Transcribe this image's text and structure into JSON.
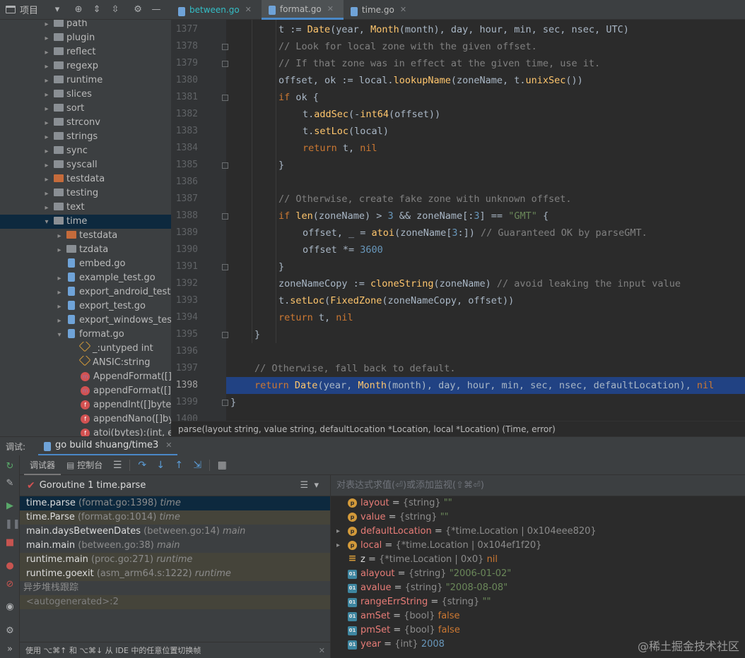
{
  "project_toolbar": {
    "title": "项目"
  },
  "tree": [
    {
      "label": "path",
      "kind": "folder",
      "depth": 0,
      "expanded": false
    },
    {
      "label": "plugin",
      "kind": "folder",
      "depth": 0,
      "expanded": false
    },
    {
      "label": "reflect",
      "kind": "folder",
      "depth": 0,
      "expanded": false
    },
    {
      "label": "regexp",
      "kind": "folder",
      "depth": 0,
      "expanded": false
    },
    {
      "label": "runtime",
      "kind": "folder",
      "depth": 0,
      "expanded": false
    },
    {
      "label": "slices",
      "kind": "folder",
      "depth": 0,
      "expanded": false
    },
    {
      "label": "sort",
      "kind": "folder",
      "depth": 0,
      "expanded": false
    },
    {
      "label": "strconv",
      "kind": "folder",
      "depth": 0,
      "expanded": false
    },
    {
      "label": "strings",
      "kind": "folder",
      "depth": 0,
      "expanded": false
    },
    {
      "label": "sync",
      "kind": "folder",
      "depth": 0,
      "expanded": false
    },
    {
      "label": "syscall",
      "kind": "folder",
      "depth": 0,
      "expanded": false
    },
    {
      "label": "testdata",
      "kind": "folder-orange",
      "depth": 0,
      "expanded": false
    },
    {
      "label": "testing",
      "kind": "folder",
      "depth": 0,
      "expanded": false
    },
    {
      "label": "text",
      "kind": "folder",
      "depth": 0,
      "expanded": false
    },
    {
      "label": "time",
      "kind": "folder",
      "depth": 0,
      "expanded": true,
      "selected": true
    },
    {
      "label": "testdata",
      "kind": "folder-orange",
      "depth": 1,
      "expanded": false
    },
    {
      "label": "tzdata",
      "kind": "folder",
      "depth": 1,
      "expanded": false
    },
    {
      "label": "embed.go",
      "kind": "gofile",
      "depth": 1,
      "leaf": true
    },
    {
      "label": "example_test.go",
      "kind": "gofile",
      "depth": 1,
      "expanded": false
    },
    {
      "label": "export_android_test",
      "kind": "gofile",
      "depth": 1,
      "expanded": false
    },
    {
      "label": "export_test.go",
      "kind": "gofile",
      "depth": 1,
      "expanded": false
    },
    {
      "label": "export_windows_tes",
      "kind": "gofile",
      "depth": 1,
      "expanded": false
    },
    {
      "label": "format.go",
      "kind": "gofile",
      "depth": 1,
      "expanded": true
    },
    {
      "label": "_:untyped int",
      "kind": "const",
      "depth": 2,
      "leaf": true
    },
    {
      "label": "ANSIC:string",
      "kind": "const",
      "depth": 2,
      "leaf": true
    },
    {
      "label": "AppendFormat([]b",
      "kind": "method",
      "depth": 2,
      "leaf": true
    },
    {
      "label": "appendFormat([]b",
      "kind": "method",
      "depth": 2,
      "leaf": true
    },
    {
      "label": "appendInt([]byte,",
      "kind": "func",
      "depth": 2,
      "leaf": true
    },
    {
      "label": "appendNano([]by",
      "kind": "func",
      "depth": 2,
      "leaf": true
    },
    {
      "label": "atoi(bytes):(int, e",
      "kind": "func",
      "depth": 2,
      "leaf": true
    }
  ],
  "tabs": [
    {
      "label": "between.go",
      "active": false,
      "style": "cyan"
    },
    {
      "label": "format.go",
      "active": true,
      "style": "normal"
    },
    {
      "label": "time.go",
      "active": false,
      "style": "normal"
    }
  ],
  "editor": {
    "current_line": "1398",
    "lines": [
      {
        "num": "1377",
        "indent": 2,
        "tokens": [
          [
            "t",
            "t :="
          ],
          [
            "t",
            " "
          ],
          [
            "fn",
            "Date"
          ],
          [
            "t",
            "(year, "
          ],
          [
            "fn",
            "Month"
          ],
          [
            "t",
            "(month), day, hour, min, sec, nsec, UTC)"
          ]
        ]
      },
      {
        "num": "1378",
        "indent": 2,
        "tokens": [
          [
            "c",
            "// Look for local zone with the given offset."
          ]
        ]
      },
      {
        "num": "1379",
        "indent": 2,
        "tokens": [
          [
            "c",
            "// If that zone was in effect at the given time, use it."
          ]
        ]
      },
      {
        "num": "1380",
        "indent": 2,
        "tokens": [
          [
            "t",
            "offset, ok := local."
          ],
          [
            "fn",
            "lookupName"
          ],
          [
            "t",
            "(zoneName, t."
          ],
          [
            "fn",
            "unixSec"
          ],
          [
            "t",
            "())"
          ]
        ]
      },
      {
        "num": "1381",
        "indent": 2,
        "tokens": [
          [
            "k",
            "if"
          ],
          [
            "t",
            " ok {"
          ]
        ]
      },
      {
        "num": "1382",
        "indent": 3,
        "tokens": [
          [
            "t",
            "t."
          ],
          [
            "fn",
            "addSec"
          ],
          [
            "t",
            "(-"
          ],
          [
            "fn",
            "int64"
          ],
          [
            "t",
            "(offset))"
          ]
        ]
      },
      {
        "num": "1383",
        "indent": 3,
        "tokens": [
          [
            "t",
            "t."
          ],
          [
            "fn",
            "setLoc"
          ],
          [
            "t",
            "(local)"
          ]
        ]
      },
      {
        "num": "1384",
        "indent": 3,
        "tokens": [
          [
            "k",
            "return"
          ],
          [
            "t",
            " t, "
          ],
          [
            "k",
            "nil"
          ]
        ]
      },
      {
        "num": "1385",
        "indent": 2,
        "tokens": [
          [
            "t",
            "}"
          ]
        ]
      },
      {
        "num": "1386",
        "indent": 0,
        "tokens": []
      },
      {
        "num": "1387",
        "indent": 2,
        "tokens": [
          [
            "c",
            "// Otherwise, create fake zone with unknown offset."
          ]
        ]
      },
      {
        "num": "1388",
        "indent": 2,
        "tokens": [
          [
            "k",
            "if"
          ],
          [
            "t",
            " "
          ],
          [
            "fn",
            "len"
          ],
          [
            "t",
            "(zoneName) > "
          ],
          [
            "n",
            "3"
          ],
          [
            "t",
            " && zoneName[:"
          ],
          [
            "n",
            "3"
          ],
          [
            "t",
            "] == "
          ],
          [
            "s",
            "\"GMT\""
          ],
          [
            "t",
            " {"
          ]
        ]
      },
      {
        "num": "1389",
        "indent": 3,
        "tokens": [
          [
            "t",
            "offset, _ = "
          ],
          [
            "fn",
            "atoi"
          ],
          [
            "t",
            "(zoneName["
          ],
          [
            "n",
            "3"
          ],
          [
            "t",
            ":]) "
          ],
          [
            "c",
            "// Guaranteed OK by parseGMT."
          ]
        ]
      },
      {
        "num": "1390",
        "indent": 3,
        "tokens": [
          [
            "t",
            "offset *= "
          ],
          [
            "n",
            "3600"
          ]
        ]
      },
      {
        "num": "1391",
        "indent": 2,
        "tokens": [
          [
            "t",
            "}"
          ]
        ]
      },
      {
        "num": "1392",
        "indent": 2,
        "tokens": [
          [
            "t",
            "zoneNameCopy := "
          ],
          [
            "fn",
            "cloneString"
          ],
          [
            "t",
            "(zoneName) "
          ],
          [
            "c",
            "// avoid leaking the input value"
          ]
        ]
      },
      {
        "num": "1393",
        "indent": 2,
        "tokens": [
          [
            "t",
            "t."
          ],
          [
            "fn",
            "setLoc"
          ],
          [
            "t",
            "("
          ],
          [
            "fn",
            "FixedZone"
          ],
          [
            "t",
            "(zoneNameCopy, offset))"
          ]
        ]
      },
      {
        "num": "1394",
        "indent": 2,
        "tokens": [
          [
            "k",
            "return"
          ],
          [
            "t",
            " t, "
          ],
          [
            "k",
            "nil"
          ]
        ]
      },
      {
        "num": "1395",
        "indent": 1,
        "tokens": [
          [
            "t",
            "}"
          ]
        ]
      },
      {
        "num": "1396",
        "indent": 0,
        "tokens": []
      },
      {
        "num": "1397",
        "indent": 1,
        "tokens": [
          [
            "c",
            "// Otherwise, fall back to default."
          ]
        ]
      },
      {
        "num": "1398",
        "indent": 1,
        "tokens": [
          [
            "k",
            "return"
          ],
          [
            "t",
            " "
          ],
          [
            "fn",
            "Date"
          ],
          [
            "t",
            "(year, "
          ],
          [
            "fn",
            "Month"
          ],
          [
            "t",
            "(month), day, hour, min, sec, nsec, defaultLocation), "
          ],
          [
            "k",
            "nil"
          ]
        ]
      },
      {
        "num": "1399",
        "indent": 0,
        "tokens": [
          [
            "t",
            "}"
          ]
        ]
      },
      {
        "num": "1400",
        "indent": 0,
        "tokens": []
      }
    ]
  },
  "hint": "parse(layout string, value string, defaultLocation *Location, local *Location) (Time, error)",
  "debug": {
    "label": "调试:",
    "session_tab": "go build shuang/time3",
    "toolbar": {
      "debugger": "调试器",
      "console": "控制台"
    },
    "goroutine": "Goroutine 1 time.parse",
    "frames": [
      {
        "func": "time.parse",
        "loc": "(format.go:1398)",
        "pkg": "time",
        "state": "sel"
      },
      {
        "func": "time.Parse",
        "loc": "(format.go:1014)",
        "pkg": "time",
        "state": "lib"
      },
      {
        "func": "main.daysBetweenDates",
        "loc": "(between.go:14)",
        "pkg": "main",
        "state": "normal"
      },
      {
        "func": "main.main",
        "loc": "(between.go:38)",
        "pkg": "main",
        "state": "normal"
      },
      {
        "func": "runtime.main",
        "loc": "(proc.go:271)",
        "pkg": "runtime",
        "state": "lib"
      },
      {
        "func": "runtime.goexit",
        "loc": "(asm_arm64.s:1222)",
        "pkg": "runtime",
        "state": "lib"
      }
    ],
    "async_title": "异步堆栈跟踪",
    "async_row": "<autogenerated>:2",
    "footer": "使用 ⌥⌘↑ 和 ⌥⌘↓ 从 IDE 中的任意位置切换帧",
    "eval_placeholder": "对表达式求值(⏎)或添加监视(⇧⌘⏎)",
    "variables": [
      {
        "badge": "p",
        "name": "layout",
        "type": "{string}",
        "value": "\"\"",
        "expandable": false,
        "vstyle": "str"
      },
      {
        "badge": "p",
        "name": "value",
        "type": "{string}",
        "value": "\"\"",
        "expandable": false,
        "vstyle": "str"
      },
      {
        "badge": "p",
        "name": "defaultLocation",
        "type": "{*time.Location | 0x104eee820}",
        "value": "",
        "expandable": true,
        "vstyle": "str"
      },
      {
        "badge": "p",
        "name": "local",
        "type": "{*time.Location | 0x104ef1f20}",
        "value": "",
        "expandable": true,
        "vstyle": "str"
      },
      {
        "badge": "=",
        "name": "z",
        "type": "{*time.Location | 0x0}",
        "value": "nil",
        "expandable": false,
        "vstyle": "kw",
        "plain": true
      },
      {
        "badge": "01",
        "name": "alayout",
        "type": "{string}",
        "value": "\"2006-01-02\"",
        "expandable": false,
        "vstyle": "str"
      },
      {
        "badge": "01",
        "name": "avalue",
        "type": "{string}",
        "value": "\"2008-08-08\"",
        "expandable": false,
        "vstyle": "str"
      },
      {
        "badge": "01",
        "name": "rangeErrString",
        "type": "{string}",
        "value": "\"\"",
        "expandable": false,
        "vstyle": "str"
      },
      {
        "badge": "01",
        "name": "amSet",
        "type": "{bool}",
        "value": "false",
        "expandable": false,
        "vstyle": "kw"
      },
      {
        "badge": "01",
        "name": "pmSet",
        "type": "{bool}",
        "value": "false",
        "expandable": false,
        "vstyle": "kw"
      },
      {
        "badge": "01",
        "name": "year",
        "type": "{int}",
        "value": "2008",
        "expandable": false,
        "vstyle": "num"
      }
    ],
    "watermark": "@稀土掘金技术社区"
  }
}
